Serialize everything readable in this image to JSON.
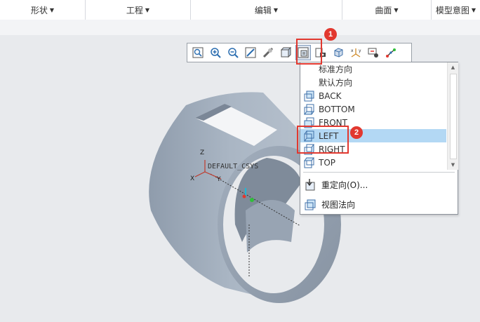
{
  "ribbon": {
    "groups": [
      {
        "label": "形状"
      },
      {
        "label": "工程"
      },
      {
        "label": "编辑"
      },
      {
        "label": "曲面"
      },
      {
        "label": "模型意图"
      }
    ]
  },
  "view_toolbar": {
    "buttons": [
      {
        "icon": "zoom-to-fit-icon"
      },
      {
        "icon": "zoom-in-icon"
      },
      {
        "icon": "zoom-out-icon"
      },
      {
        "icon": "repaint-icon"
      },
      {
        "icon": "display-style-icon"
      },
      {
        "icon": "shaded-cube-icon"
      },
      {
        "icon": "saved-orientations-icon",
        "active": true
      },
      {
        "icon": "view-manager-icon"
      },
      {
        "icon": "perspective-view-icon"
      },
      {
        "icon": "datum-display-icon"
      },
      {
        "icon": "annotation-display-icon"
      },
      {
        "icon": "spin-center-icon"
      }
    ]
  },
  "orientation_menu": {
    "items": [
      {
        "label": "标准方向",
        "icon": ""
      },
      {
        "label": "默认方向",
        "icon": ""
      },
      {
        "label": "BACK",
        "icon": "view-cube-icon"
      },
      {
        "label": "BOTTOM",
        "icon": "view-cube-icon"
      },
      {
        "label": "FRONT",
        "icon": "view-cube-icon"
      },
      {
        "label": "LEFT",
        "icon": "view-cube-icon",
        "selected": true
      },
      {
        "label": "RIGHT",
        "icon": "view-cube-icon"
      },
      {
        "label": "TOP",
        "icon": "view-cube-icon"
      }
    ],
    "commands": [
      {
        "label": "重定向(O)...",
        "icon": "reorient-icon"
      },
      {
        "label": "视图法向",
        "icon": "view-normal-icon"
      }
    ]
  },
  "model": {
    "csys_label": "DEFAULT_CSYS",
    "axis_x": "X",
    "axis_y": "Y",
    "axis_z": "Z"
  },
  "callouts": [
    {
      "number": "1"
    },
    {
      "number": "2"
    }
  ],
  "colors": {
    "accent_red": "#e2382f",
    "selection": "#b3d8f4",
    "model_fill": "#a9b6c4"
  }
}
